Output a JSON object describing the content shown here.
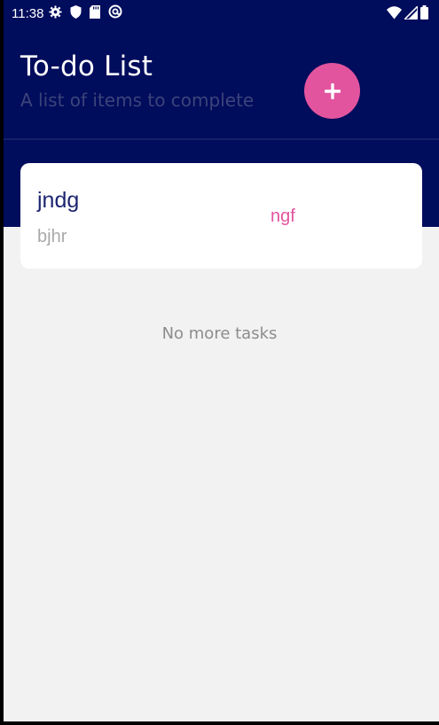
{
  "status_bar": {
    "time": "11:38",
    "icons": [
      "gear-icon",
      "shield-icon",
      "sd-card-icon",
      "at-sign-icon"
    ],
    "right_icons": [
      "wifi-icon",
      "signal-icon",
      "battery-icon"
    ]
  },
  "header": {
    "title": "To-do List",
    "subtitle": "A list of items to complete",
    "add_button_label": "+"
  },
  "tasks": [
    {
      "title": "jndg",
      "description": "bjhr",
      "tag": "ngf"
    }
  ],
  "empty_message": "No more tasks",
  "colors": {
    "header_bg": "#000c5c",
    "accent": "#e3549e",
    "body_bg": "#f2f2f2",
    "card_bg": "#ffffff",
    "task_title": "#1d2570",
    "muted": "#a9a9a9"
  }
}
